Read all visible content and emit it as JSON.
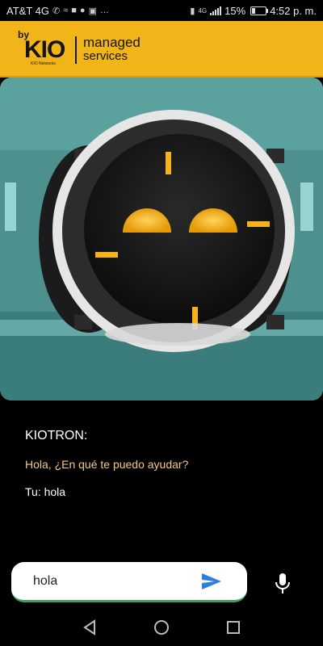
{
  "status_bar": {
    "carrier": "AT&T 4G",
    "battery_percent": "15%",
    "time": "4:52 p. m.",
    "network_badge": "4G",
    "icons": [
      "whatsapp-icon",
      "swirl-icon",
      "square-icon",
      "spotify-icon",
      "facebook-icon",
      "more-icon",
      "vibrate-icon",
      "signal-icon",
      "battery-icon"
    ]
  },
  "header": {
    "logo_by": "by",
    "logo_brand": "KIO",
    "logo_group": "KIO Networks",
    "tagline_line1": "managed",
    "tagline_line2": "services",
    "background_color": "#f2b519"
  },
  "hero": {
    "subject": "kiotron-robot",
    "eye_color": "#f6b21c"
  },
  "chat": {
    "title": "KIOTRON:",
    "bot_message": "Hola, ¿En qué te puedo ayudar?",
    "user_message": "Tu: hola",
    "bot_color": "#f5c983"
  },
  "input": {
    "value": "hola",
    "accent_color": "#3aa35b",
    "send_icon": "send-icon",
    "mic_icon": "mic-icon"
  },
  "nav": {
    "buttons": [
      "back-icon",
      "home-icon",
      "recents-icon"
    ]
  }
}
